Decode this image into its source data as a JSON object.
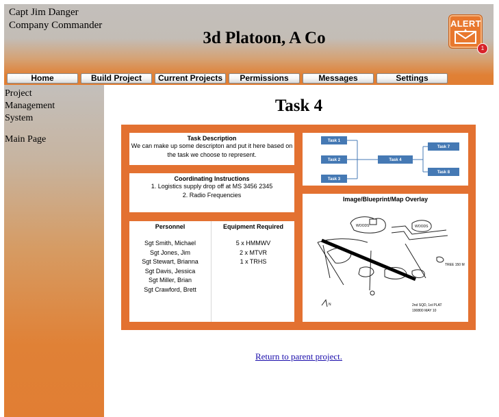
{
  "header": {
    "user_name": "Capt Jim Danger",
    "user_role": "Company Commander",
    "unit_title": "3d Platoon, A Co",
    "alert": {
      "label": "ALERT",
      "count": "1"
    }
  },
  "nav": {
    "items": [
      {
        "label": "Home"
      },
      {
        "label": "Build Project"
      },
      {
        "label": "Current Projects"
      },
      {
        "label": "Permissions"
      },
      {
        "label": "Messages"
      },
      {
        "label": "Settings"
      }
    ]
  },
  "sidebar": {
    "system_name": "Project Management System",
    "main_link": "Main Page"
  },
  "main": {
    "title": "Task 4",
    "task_description": {
      "heading": "Task Description",
      "text": "We can make up some descripton and put it here based on the task we choose to represent."
    },
    "coordinating_instructions": {
      "heading": "Coordinating Instructions",
      "items": [
        "1. Logistics supply drop off at MS 3456 2345",
        "2. Radio Frequencies"
      ]
    },
    "personnel": {
      "heading": "Personnel",
      "names": [
        "Sgt Smith, Michael",
        "Sgt Jones, Jim",
        "Sgt Stewart, Brianna",
        "Sgt Davis, Jessica",
        "Sgt Miller, Brian",
        "Sgt Crawford, Brett"
      ]
    },
    "equipment": {
      "heading": "Equipment Required",
      "items": [
        "5 x HMMWV",
        "2 x MTVR",
        "1 x TRHS"
      ]
    },
    "flowchart": {
      "nodes": [
        "Task 1",
        "Task 2",
        "Task 3",
        "Task 4",
        "Task 7",
        "Task 8"
      ]
    },
    "overlay": {
      "heading": "Image/Blueprint/Map Overlay",
      "sketch_labels": [
        "WOODS",
        "WOODS",
        "TREE 150 M",
        "2nd SQD, 1st PLAT",
        "190800 MAY 10",
        "N"
      ]
    },
    "return_link": "Return to parent project.",
    "colors": {
      "board_orange": "#e37131",
      "task_node_blue": "#4579b4",
      "header_orange": "#e17e33"
    }
  }
}
